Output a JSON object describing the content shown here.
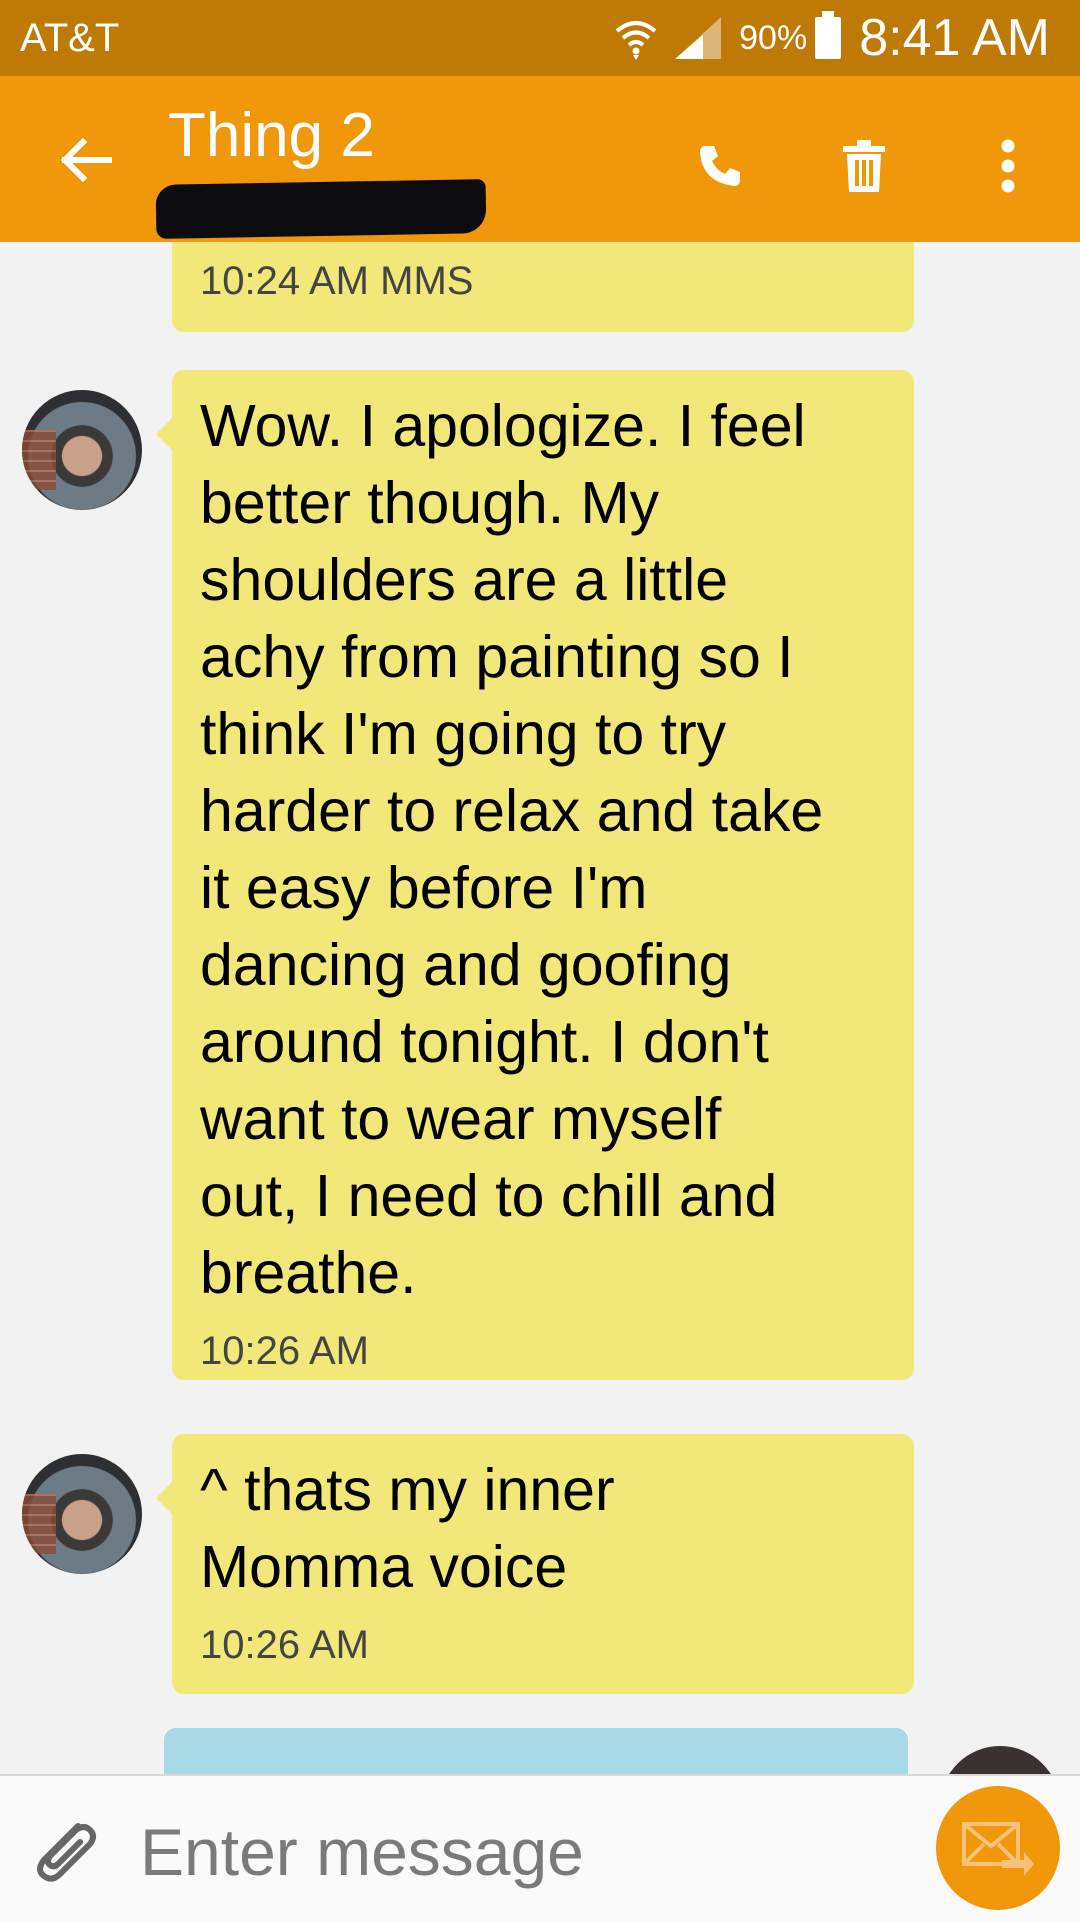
{
  "status_bar": {
    "carrier": "AT&T",
    "battery": "90%",
    "time": "8:41 AM"
  },
  "header": {
    "contact_name": "Thing 2",
    "icons": [
      "back-arrow-icon",
      "phone-icon",
      "trash-icon",
      "more-vert-icon"
    ],
    "color": "#f0970a"
  },
  "messages": [
    {
      "direction": "incoming",
      "text": "",
      "meta": "10:24 AM MMS"
    },
    {
      "direction": "incoming",
      "text": "Wow. I apologize. I feel\nbetter though. My\nshoulders are a little\nachy from painting so I\nthink I'm going to try\nharder to relax and take\nit easy before I'm\ndancing and goofing\naround tonight. I don't\nwant to wear myself\nout, I need to chill and\nbreathe.",
      "meta": "10:26 AM"
    },
    {
      "direction": "incoming",
      "text": "^ thats my inner\nMomma voice",
      "meta": "10:26 AM"
    }
  ],
  "composer": {
    "placeholder": "Enter message",
    "icons": [
      "paperclip-icon",
      "send-mail-icon"
    ]
  },
  "colors": {
    "incoming_bubble": "#f2e87a",
    "outgoing_bubble": "#a9d8e6",
    "status_bar": "#bf7a06"
  }
}
